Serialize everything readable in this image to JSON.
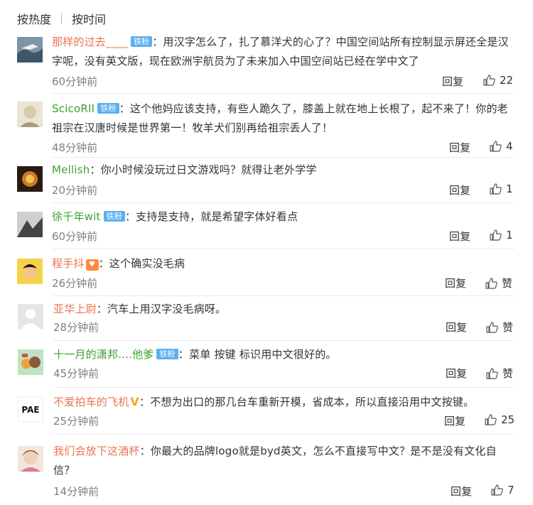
{
  "sort": {
    "hot": "按热度",
    "time": "按时间"
  },
  "comments": [
    {
      "user": "那样的过去____",
      "badge": "铁粉",
      "text": "：用汉字怎么了，扎了慕洋犬的心了？中国空间站所有控制显示屏还全是汉字呢，没有英文版，现在欧洲宇航员为了未来加入中国空间站已经在学中文了",
      "time": "60分钟前",
      "reply": "回复",
      "likes": "22"
    },
    {
      "user": "ScicoRII",
      "badge": "铁粉",
      "text": "：这个他妈应该支持，有些人跪久了，膝盖上就在地上长根了，起不来了！你的老祖宗在汉唐时候是世界第一！牧羊犬们别再给祖宗丢人了！",
      "time": "48分钟前",
      "reply": "回复",
      "likes": "4"
    },
    {
      "user": "Mellish",
      "text": "：你小时候没玩过日文游戏吗？就得让老外学学",
      "time": "20分钟前",
      "reply": "回复",
      "likes": "1"
    },
    {
      "user": "徐千年wit",
      "badge": "铁粉",
      "text": "：支持是支持，就是希望字体好看点",
      "time": "60分钟前",
      "reply": "回复",
      "likes": "1"
    },
    {
      "user": "程手抖",
      "text": "：这个确实没毛病",
      "time": "26分钟前",
      "reply": "回复",
      "likes": "赞"
    },
    {
      "user": "亚华上尉",
      "text": "：汽车上用汉字没毛病呀。",
      "time": "28分钟前",
      "reply": "回复",
      "likes": "赞"
    },
    {
      "user": "十一月的潇邦....他爹",
      "badge": "铁粉",
      "text": "：菜单 按键 标识用中文很好的。",
      "time": "45分钟前",
      "reply": "回复",
      "likes": "赞"
    },
    {
      "user": "不爱拍车的飞机",
      "text": "：不想为出口的那几台车重新开模，省成本，所以直接沿用中文按键。",
      "time": "25分钟前",
      "reply": "回复",
      "likes": "25"
    },
    {
      "user": "我们会放下这酒杯",
      "text": "：你最大的品牌logo就是byd英文，怎么不直接写中文？是不是没有文化自信？",
      "time": "14分钟前",
      "reply": "回复",
      "likes": "7"
    }
  ],
  "avatar_logo_text": "PAE",
  "colors": {
    "username": "#eb7350",
    "username_alt": "#3aa12e",
    "badge": "#5ab0f2",
    "meta": "#808080"
  }
}
